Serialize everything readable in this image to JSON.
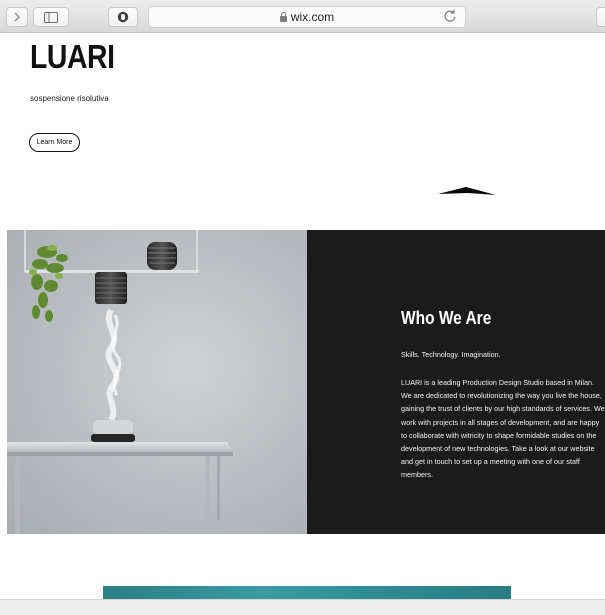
{
  "browser": {
    "url": "wix.com"
  },
  "hero": {
    "brand": "LUARI",
    "tagline": "sospensione risolutiva",
    "cta_label": "Learn More"
  },
  "about": {
    "title": "Who We Are",
    "subtitle": "Skills. Technology. Imagination.",
    "body": "LUARI is a leading Production Design Studio based in Milan. We are dedicated to revolutionizing the way you live the house, gaining the trust of clients by our high standards of services. We work with projects in all stages of development, and are happy to collaborate with witricity to shape formidable studies on the development of new technologies. Take a look at our website and get in touch to set up a meeting with one of our staff members."
  },
  "colors": {
    "dark_panel": "#1b1b1b",
    "accent_teal": "#3a9aa0"
  },
  "icons": [
    "back-icon",
    "sidebar-icon",
    "shield-icon",
    "lock-icon",
    "reload-icon"
  ]
}
